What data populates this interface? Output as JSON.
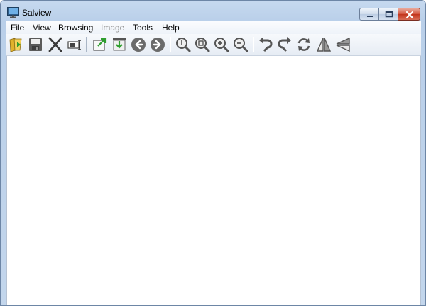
{
  "window": {
    "title": "Salview"
  },
  "menu": [
    {
      "label": "File",
      "enabled": true
    },
    {
      "label": "View",
      "enabled": true
    },
    {
      "label": "Browsing",
      "enabled": true
    },
    {
      "label": "Image",
      "enabled": false
    },
    {
      "label": "Tools",
      "enabled": true
    },
    {
      "label": "Help",
      "enabled": true
    }
  ],
  "toolbar": {
    "icons": [
      "open-folder-icon",
      "save-icon",
      "delete-icon",
      "rename-icon",
      "export-icon",
      "import-icon",
      "previous-icon",
      "next-icon",
      "zoom-actual-icon",
      "zoom-fit-icon",
      "zoom-in-icon",
      "zoom-out-icon",
      "rotate-left-icon",
      "rotate-right-icon",
      "refresh-icon",
      "flip-horizontal-icon",
      "flip-vertical-icon"
    ]
  }
}
